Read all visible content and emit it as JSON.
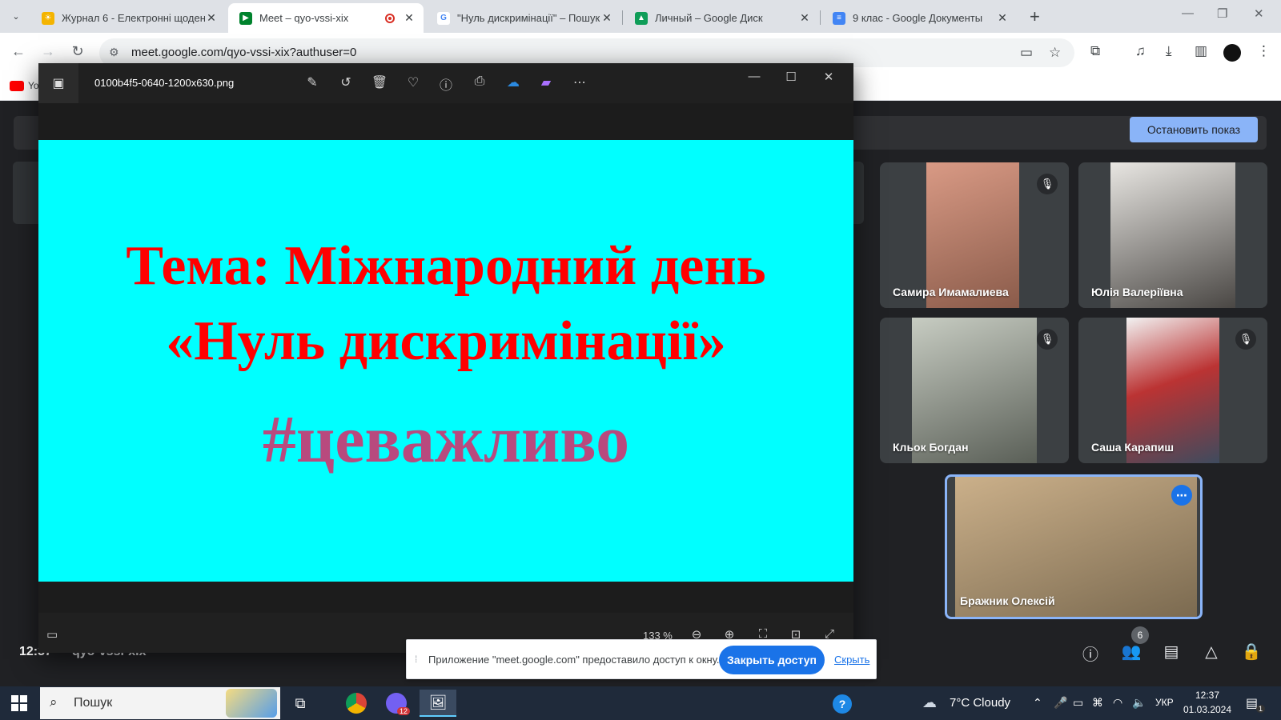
{
  "browser": {
    "tabs": [
      {
        "title": "Журнал 6 - Електронні щоден",
        "favicon_color": "#f4b400",
        "active": false
      },
      {
        "title": "Meet – qyo-vssi-xix",
        "favicon_color": "#00832d",
        "active": true
      },
      {
        "title": "\"Нуль дискримінації\" – Пошук",
        "favicon_color": "#4285f4",
        "active": false
      },
      {
        "title": "Личный – Google Диск",
        "favicon_color": "#0f9d58",
        "active": false
      },
      {
        "title": "9 клас - Google Документы",
        "favicon_color": "#4285f4",
        "active": false
      }
    ],
    "url": "meet.google.com/qyo-vssi-xix?authuser=0",
    "bookmark_label": "Yo"
  },
  "meet": {
    "stop_presenting_label": "Остановить показ",
    "meeting_time": "12:37",
    "meeting_code": "qyo-vssi-xix",
    "people_count": "6",
    "participants": [
      {
        "name": "Самира Имамалиева",
        "muted": true,
        "video_color": "#c9826e"
      },
      {
        "name": "Юлія Валеріївна",
        "muted": false,
        "video_color": "#d8d4cf"
      },
      {
        "name": "Кльок Богдан",
        "muted": true,
        "video_color": "#8a8f86"
      },
      {
        "name": "Саша Карапиш",
        "muted": true,
        "video_color": "#e4e4e4"
      }
    ],
    "self": {
      "name": "Бражник Олексій",
      "video_color": "#b8976f"
    }
  },
  "viewer": {
    "filename": "0100b4f5-0640-1200x630.png",
    "zoom": "133 %",
    "slide": {
      "line1": "Тема: Міжнародний день",
      "line2": "«Нуль дискримінації»",
      "hashtag": "#цеважливо"
    },
    "slide_bg": "#00ffff",
    "title_color": "#ff0000",
    "hashtag_color": "#b84a7e"
  },
  "share_notice": {
    "text": "Приложение \"meet.google.com\" предоставило доступ к окну.",
    "stop_label": "Закрыть доступ",
    "hide_label": "Скрыть"
  },
  "taskbar": {
    "search_placeholder": "Пошук",
    "weather": "7°C  Cloudy",
    "language": "УКР",
    "time": "12:37",
    "date": "01.03.2024",
    "viber_badge": "12",
    "notifications": "1"
  }
}
